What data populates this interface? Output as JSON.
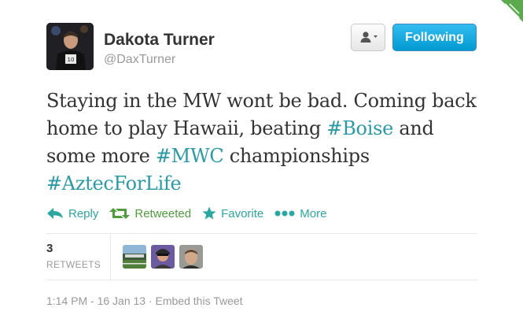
{
  "profile": {
    "name": "Dakota Turner",
    "handle": "@DaxTurner"
  },
  "buttons": {
    "follow_label": "Following"
  },
  "tweet": {
    "segments": [
      {
        "text": "Staying in the MW wont be bad. Coming back home to play Hawaii, beating ",
        "hashtag": false
      },
      {
        "text": "#Boise",
        "hashtag": true
      },
      {
        "text": " and some more ",
        "hashtag": false
      },
      {
        "text": "#MWC",
        "hashtag": true
      },
      {
        "text": " championships ",
        "hashtag": false
      },
      {
        "text": "#AztecForLife",
        "hashtag": true
      }
    ]
  },
  "actions": {
    "reply": "Reply",
    "retweeted": "Retweeted",
    "favorite": "Favorite",
    "more": "More"
  },
  "stats": {
    "retweet_count": "3",
    "retweet_label": "RETWEETS"
  },
  "footer": {
    "timestamp": "1:14 PM - 16 Jan 13",
    "separator": " · ",
    "embed_link": "Embed this Tweet"
  },
  "colors": {
    "hashtag": "#2a9ba5",
    "action": "#2aa7a0",
    "retweeted": "#4f9b3e",
    "follow_button": "#019ad2"
  },
  "icons": [
    "user-menu-icon",
    "reply-icon",
    "retweet-icon",
    "star-icon",
    "more-dots-icon"
  ]
}
